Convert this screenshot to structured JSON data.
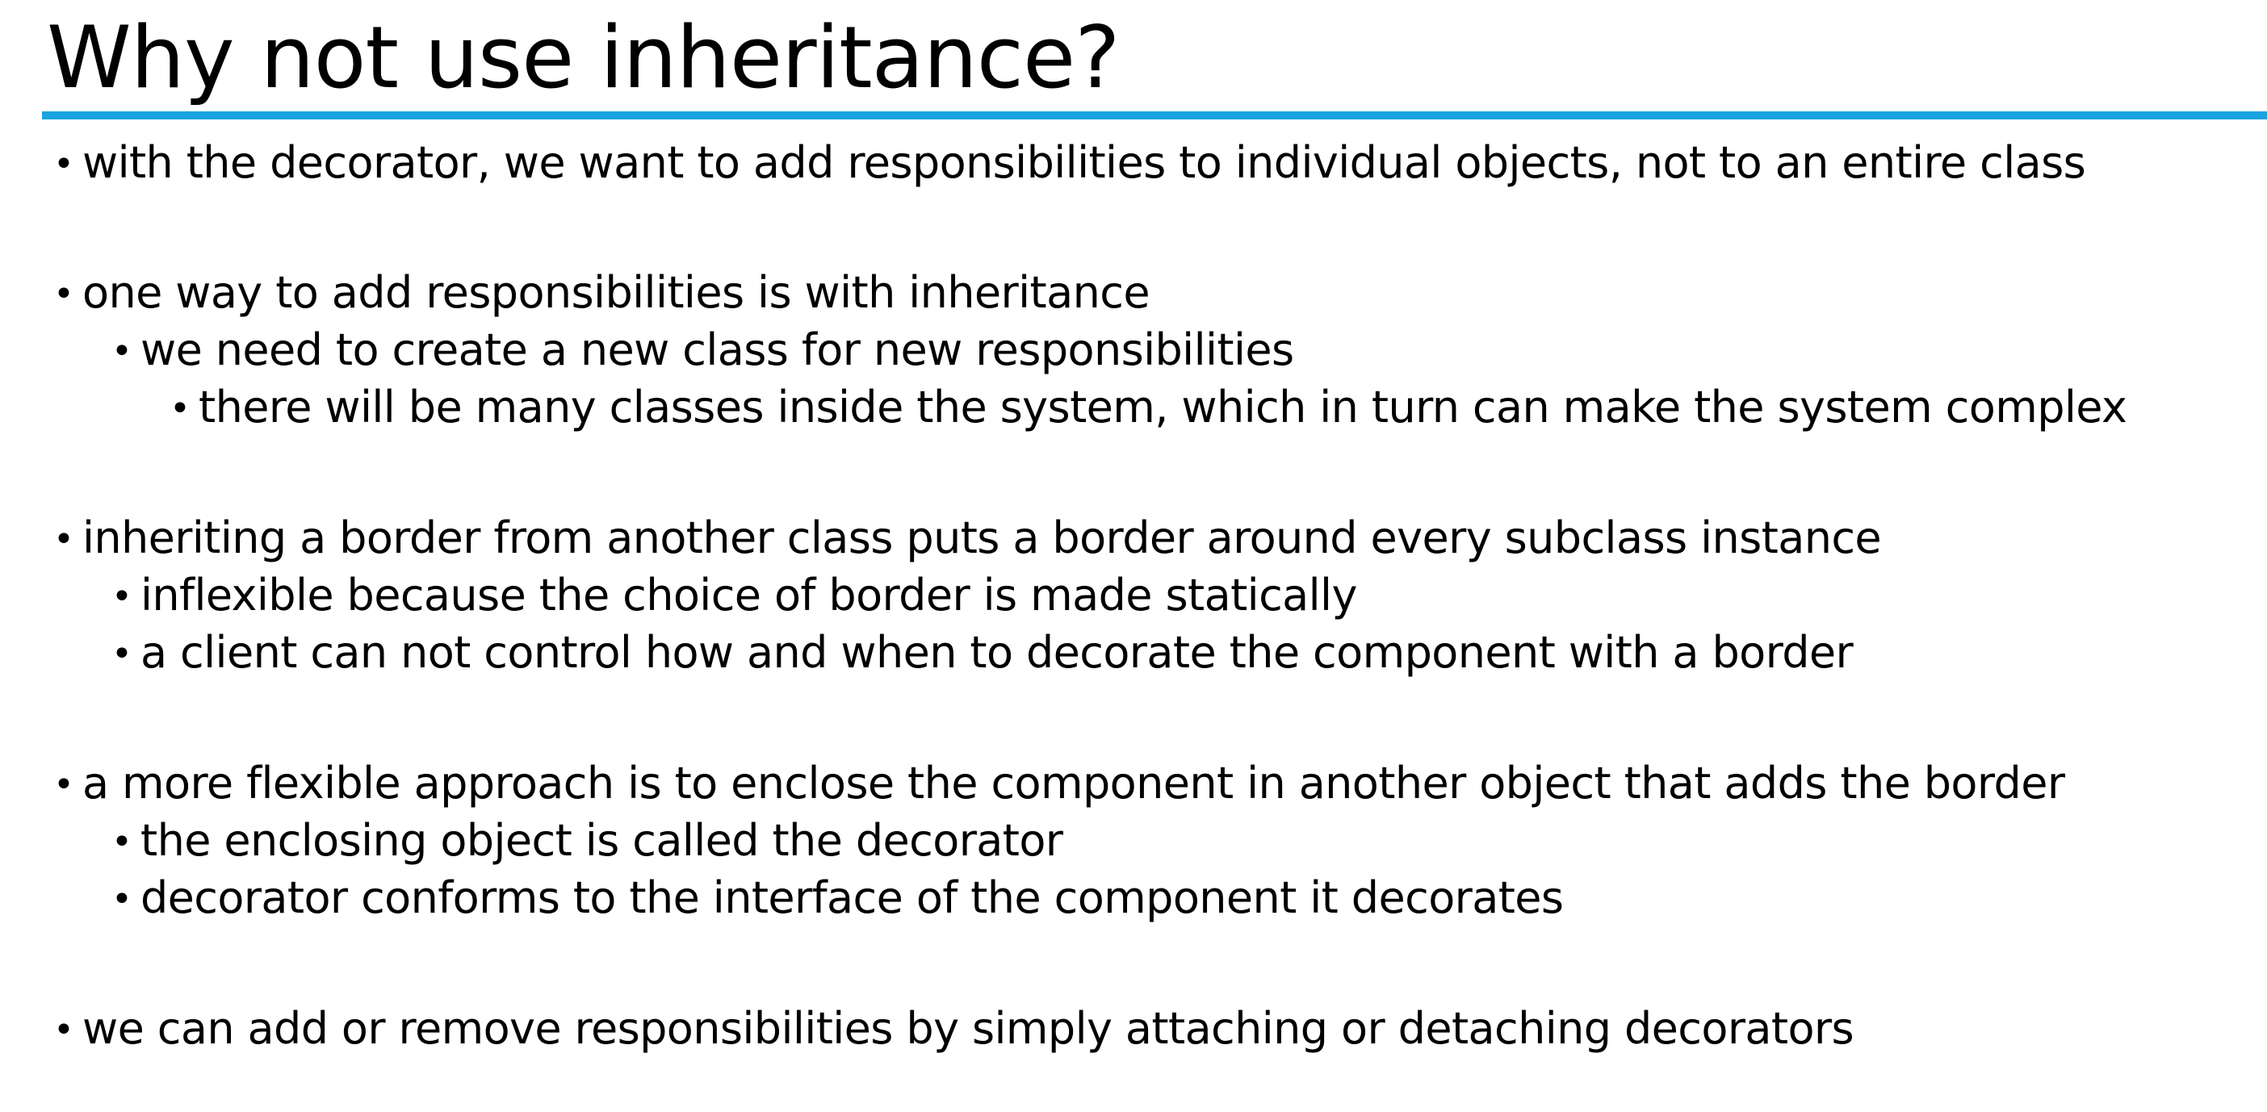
{
  "slide": {
    "title": "Why not use inheritance?",
    "bullet_char": "•",
    "accent_color": "#1aa3e0"
  },
  "bullets": [
    {
      "level": 1,
      "text": "with the decorator, we want to add responsibilities to individual objects, not to an entire class"
    },
    {
      "level": 1,
      "text": "one way to add responsibilities is with inheritance"
    },
    {
      "level": 2,
      "text": "we need to create a new class for new responsibilities"
    },
    {
      "level": 3,
      "text": "there will be many classes inside the system, which in turn can make the system complex"
    },
    {
      "level": 1,
      "text": "inheriting a border from another class puts a border around every subclass instance"
    },
    {
      "level": 2,
      "text": "inflexible because the choice of border is made statically"
    },
    {
      "level": 2,
      "text": "a client can not control how and when to decorate the component with a border"
    },
    {
      "level": 1,
      "text": "a more flexible approach is to enclose the component in another object that adds the border"
    },
    {
      "level": 2,
      "text": "the enclosing object is called the decorator"
    },
    {
      "level": 2,
      "text": "decorator conforms to the interface of the component it decorates"
    },
    {
      "level": 1,
      "text": "we can add or remove responsibilities by simply attaching or detaching decorators"
    }
  ]
}
